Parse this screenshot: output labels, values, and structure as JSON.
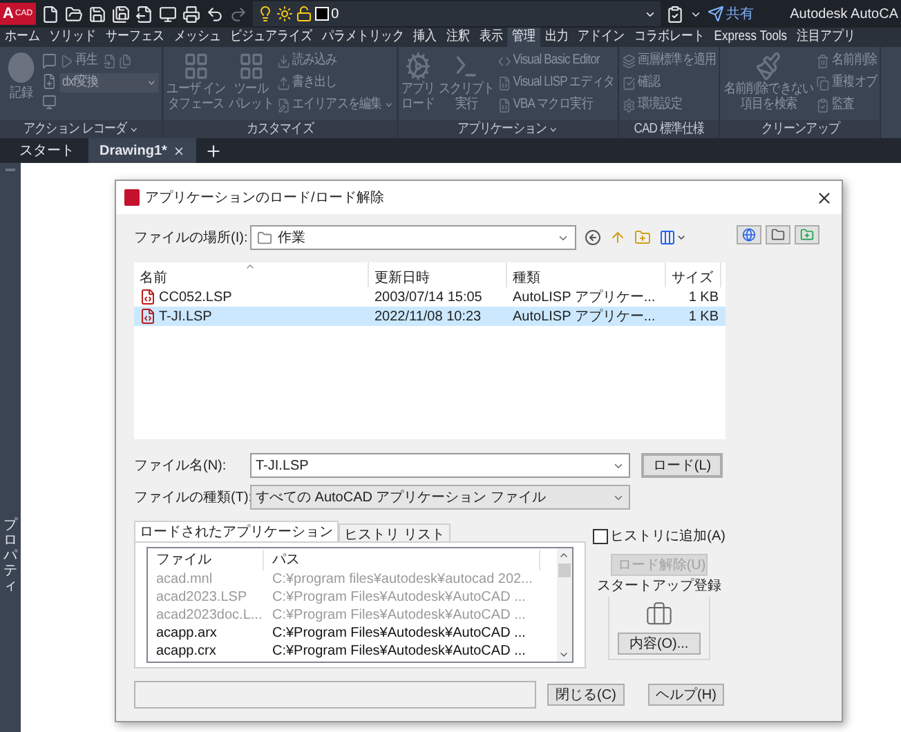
{
  "app_bar": {
    "logo_mark": "A",
    "logo_text": "CAD",
    "layer": "0",
    "share": "共有",
    "title": "Autodesk AutoCA"
  },
  "ribbon_tabs": [
    {
      "label": "ホーム",
      "selected": false
    },
    {
      "label": "ソリッド",
      "selected": false
    },
    {
      "label": "サーフェス",
      "selected": false
    },
    {
      "label": "メッシュ",
      "selected": false
    },
    {
      "label": "ビジュアライズ",
      "selected": false
    },
    {
      "label": "パラメトリック",
      "selected": false
    },
    {
      "label": "挿入",
      "selected": false
    },
    {
      "label": "注釈",
      "selected": false
    },
    {
      "label": "表示",
      "selected": false
    },
    {
      "label": "管理",
      "selected": true
    },
    {
      "label": "出力",
      "selected": false
    },
    {
      "label": "アドイン",
      "selected": false
    },
    {
      "label": "コラボレート",
      "selected": false
    },
    {
      "label": "Express Tools",
      "selected": false
    },
    {
      "label": "注目アプリ",
      "selected": false
    }
  ],
  "ribbon_panels": [
    {
      "title": "アクション レコーダ",
      "has_menu": true,
      "large": [
        {
          "lines": [
            "記録"
          ]
        }
      ],
      "small": [
        {
          "label": "再生"
        }
      ],
      "dropdown": "dxf変換"
    },
    {
      "title": "カスタマイズ",
      "large": [
        {
          "lines": [
            "ユーザ イン",
            "タフェース"
          ]
        },
        {
          "lines": [
            "ツール",
            "パレット"
          ]
        }
      ],
      "small": [
        {
          "label": "読み込み"
        },
        {
          "label": "書き出し"
        },
        {
          "label": "エイリアスを編集",
          "has_menu": true
        }
      ]
    },
    {
      "title": "アプリケーション",
      "has_menu": true,
      "large": [
        {
          "lines": [
            "アプリ",
            "ロード"
          ]
        },
        {
          "lines": [
            "スクリプト",
            "実行"
          ]
        }
      ],
      "small": [
        {
          "label": "Visual Basic Editor"
        },
        {
          "label": "Visual LISP エディタ"
        },
        {
          "label": "VBA マクロ実行"
        }
      ]
    },
    {
      "title": "CAD 標準仕様",
      "small": [
        {
          "label": "画層標準を適用"
        },
        {
          "label": "確認"
        },
        {
          "label": "環境設定"
        }
      ]
    },
    {
      "title": "クリーンアップ",
      "large": [
        {
          "lines": [
            "名前削除できない",
            "項目を検索"
          ]
        }
      ],
      "small": [
        {
          "label": "名前削除"
        },
        {
          "label": "重複オブ"
        },
        {
          "label": "監査"
        }
      ]
    }
  ],
  "doc_tabs": [
    {
      "label": "スタート",
      "selected": false
    },
    {
      "label": "Drawing1*",
      "selected": true,
      "closable": true
    }
  ],
  "side_panel": {
    "label": "プロパティ"
  },
  "dialog": {
    "title": "アプリケーションのロード/ロード解除",
    "location_label": "ファイルの場所(I):",
    "location": "作業",
    "files": {
      "columns": [
        "名前",
        "更新日時",
        "種類",
        "サイズ"
      ],
      "rows": [
        {
          "cells": [
            "CC052.LSP",
            "2003/07/14 15:05",
            "AutoLISP アプリケー...",
            "1 KB"
          ],
          "selected": false
        },
        {
          "cells": [
            "T-JI.LSP",
            "2022/11/08 10:23",
            "AutoLISP アプリケー...",
            "1 KB"
          ],
          "selected": true
        }
      ]
    },
    "file_name_label": "ファイル名(N):",
    "file_name": "T-JI.LSP",
    "load_button": "ロード(L)",
    "file_type_label": "ファイルの種類(T):",
    "file_type": "すべての AutoCAD アプリケーション ファイル",
    "tabs": [
      {
        "label": "ロードされたアプリケーション",
        "selected": true
      },
      {
        "label": "ヒストリ リスト",
        "selected": false
      }
    ],
    "loaded_apps": {
      "columns": [
        "ファイル",
        "パス"
      ],
      "rows": [
        {
          "file": "acad.mnl",
          "path": "C:¥program files¥autodesk¥autocad 202...",
          "dimmed": true
        },
        {
          "file": "acad2023.LSP",
          "path": "C:¥Program Files¥Autodesk¥AutoCAD ...",
          "dimmed": true
        },
        {
          "file": "acad2023doc.L...",
          "path": "C:¥Program Files¥Autodesk¥AutoCAD ...",
          "dimmed": true
        },
        {
          "file": "acapp.arx",
          "path": "C:¥Program Files¥Autodesk¥AutoCAD ...",
          "dimmed": false
        },
        {
          "file": "acapp.crx",
          "path": "C:¥Program Files¥Autodesk¥AutoCAD ...",
          "dimmed": false
        }
      ]
    },
    "add_to_history": {
      "label": "ヒストリに追加(A)",
      "checked": false
    },
    "unload_button": {
      "label": "ロード解除(U)",
      "disabled": true
    },
    "startup_group": {
      "title": "スタートアップ登録",
      "button": "内容(O)..."
    },
    "close_button": "閉じる(C)",
    "help_button": "ヘルプ(H)"
  }
}
